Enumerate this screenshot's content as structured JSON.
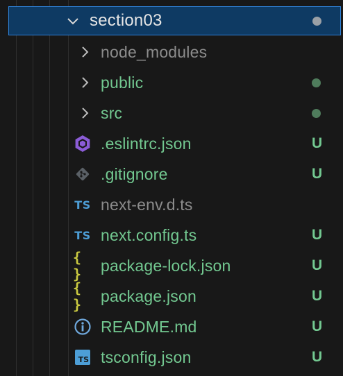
{
  "colors": {
    "background": "#181818",
    "selection_bg": "#0e3a63",
    "selection_border": "#2f81d6",
    "untracked_green": "#73c991",
    "ignored_gray": "#8c8c8c",
    "dot_green": "#4f7c5c",
    "dot_gray": "#9aa0a6",
    "ts_blue": "#4d9ed6",
    "json_yellow": "#cbcb41",
    "eslint_purple": "#8b5cd6",
    "git_gray": "#5a6066",
    "info_blue": "#6fa8dc"
  },
  "explorer": {
    "root_folder": {
      "label": "section03",
      "icon": "chevron-down-icon",
      "status": "modified-dot"
    },
    "items": [
      {
        "label": "node_modules",
        "type": "folder",
        "icon": "chevron-right-icon",
        "status": ""
      },
      {
        "label": "public",
        "type": "folder",
        "icon": "chevron-right-icon",
        "status": "dot"
      },
      {
        "label": "src",
        "type": "folder",
        "icon": "chevron-right-icon",
        "status": "dot"
      },
      {
        "label": ".eslintrc.json",
        "type": "file",
        "icon": "eslint-icon",
        "status": "U"
      },
      {
        "label": ".gitignore",
        "type": "file",
        "icon": "git-icon",
        "status": "U"
      },
      {
        "label": "next-env.d.ts",
        "type": "file",
        "icon": "typescript-icon",
        "icon_text": "TS",
        "status": ""
      },
      {
        "label": "next.config.ts",
        "type": "file",
        "icon": "typescript-icon",
        "icon_text": "TS",
        "status": "U"
      },
      {
        "label": "package-lock.json",
        "type": "file",
        "icon": "json-icon",
        "icon_text": "{ }",
        "status": "U"
      },
      {
        "label": "package.json",
        "type": "file",
        "icon": "json-icon",
        "icon_text": "{ }",
        "status": "U"
      },
      {
        "label": "README.md",
        "type": "file",
        "icon": "info-icon",
        "status": "U"
      },
      {
        "label": "tsconfig.json",
        "type": "file",
        "icon": "tsconfig-icon",
        "icon_text": "TS",
        "status": "U"
      }
    ]
  }
}
